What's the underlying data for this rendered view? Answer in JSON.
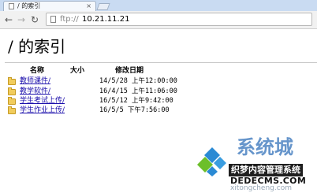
{
  "browser": {
    "tab_title": "/ 的索引",
    "tab_close": "×",
    "url_prefix": "ftp://",
    "url_host": "10.21.11.21"
  },
  "page": {
    "heading": "/ 的索引",
    "columns": {
      "name": "名称",
      "size": "大小",
      "date": "修改日期"
    },
    "rows": [
      {
        "name": "教师课件/",
        "size": "",
        "date": "14/5/28 上午12:00:00"
      },
      {
        "name": "教学软件/",
        "size": "",
        "date": "16/4/15 上午11:06:00"
      },
      {
        "name": "学生考试上传/",
        "size": "",
        "date": "16/5/12 上午9:42:00"
      },
      {
        "name": "学生作业上传/",
        "size": "",
        "date": "16/5/5 下午7:56:00"
      }
    ]
  },
  "watermark": {
    "brand": "系统城",
    "title": "织梦内容管理系统",
    "url_line1": "DEDECMS.COM",
    "url_line2": "xitongcheng.com",
    "colors": {
      "blue": "#2a8ad4",
      "green": "#6cbf2a",
      "dark": "#1f1f1f"
    }
  }
}
